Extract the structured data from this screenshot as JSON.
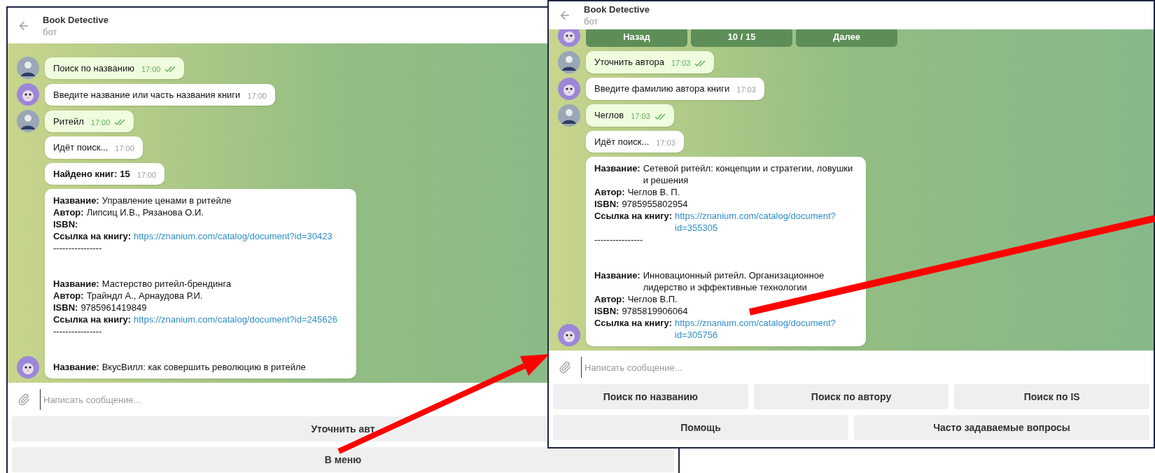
{
  "windows": [
    {
      "title": "Book Detective",
      "subtitle": "бот",
      "messages": [
        {
          "kind": "outgoing",
          "text": "Поиск по названию",
          "time": "17:00",
          "read": true,
          "avatar": true
        },
        {
          "kind": "incoming",
          "text": "Введите название или часть названия книги",
          "time": "17:00",
          "bold": false,
          "avatar": true
        },
        {
          "kind": "outgoing",
          "text": "Ритейл",
          "time": "17:00",
          "read": true,
          "avatar": true
        },
        {
          "kind": "incoming",
          "text": "Идёт поиск...",
          "time": "17:00",
          "bold": false
        },
        {
          "kind": "incoming",
          "text": "Найдено книг: 15",
          "time": "17:00",
          "bold": true
        },
        {
          "kind": "books",
          "avatar": true,
          "lines": [
            {
              "kind": "field",
              "label": "Название:",
              "value": "Управление ценами в ритейле"
            },
            {
              "kind": "field",
              "label": "Автор:",
              "value": "Липсиц И.В., Рязанова О.И."
            },
            {
              "kind": "field",
              "label": "ISBN:"
            },
            {
              "kind": "link",
              "label": "Ссылка на книгу:",
              "url": "https://znanium.com/catalog/document?id=30423"
            },
            {
              "kind": "rule",
              "text": "----------------"
            },
            {
              "kind": "gap"
            },
            {
              "kind": "gap"
            },
            {
              "kind": "field",
              "label": "Название:",
              "value": "Мастерство ритейл-брендинга"
            },
            {
              "kind": "field",
              "label": "Автор:",
              "value": "Трайндл А., Арнаудова Р.И."
            },
            {
              "kind": "field",
              "label": "ISBN:",
              "value": "9785961419849"
            },
            {
              "kind": "link",
              "label": "Ссылка на книгу:",
              "url": "https://znanium.com/catalog/document?id=245626"
            },
            {
              "kind": "rule",
              "text": "----------------"
            },
            {
              "kind": "gap"
            },
            {
              "kind": "gap"
            },
            {
              "kind": "field",
              "label": "Название:",
              "value": "ВкусВилл: как совершить революцию в ритейле"
            }
          ]
        }
      ],
      "input": {
        "placeholder": "Написать сообщение..."
      },
      "keyboard": [
        {
          "buttons": [
            "Уточнить авт"
          ]
        },
        {
          "buttons": [
            "В меню"
          ]
        }
      ]
    },
    {
      "title": "Book Detective",
      "subtitle": "бот",
      "messages": [
        {
          "kind": "buttons",
          "buttons": [
            "Назад",
            "10 / 15",
            "Далее"
          ],
          "avatar": true
        },
        {
          "kind": "outgoing",
          "text": "Уточнить автора",
          "time": "17:03",
          "read": true,
          "avatar": true
        },
        {
          "kind": "incoming",
          "text": "Введите фамилию автора книги",
          "time": "17:03",
          "bold": false,
          "avatar": true
        },
        {
          "kind": "outgoing",
          "text": "Чеглов",
          "time": "17:03",
          "read": true,
          "avatar": true
        },
        {
          "kind": "incoming",
          "text": "Идёт поиск...",
          "time": "17:03",
          "bold": false
        },
        {
          "kind": "books",
          "avatar": true,
          "lines": [
            {
              "kind": "field",
              "label": "Название:",
              "value": "Сетевой ритейл: концепции и стратегии, ловушки и решения"
            },
            {
              "kind": "field",
              "label": "Автор:",
              "value": "Чеглов В. П."
            },
            {
              "kind": "field",
              "label": "ISBN:",
              "value": "9785955802954"
            },
            {
              "kind": "link",
              "label": "Ссылка на книгу:",
              "url": "https://znanium.com/catalog/document?id=355305"
            },
            {
              "kind": "rule",
              "text": "----------------"
            },
            {
              "kind": "gap"
            },
            {
              "kind": "gap"
            },
            {
              "kind": "field",
              "label": "Название:",
              "value": "Инновационный ритейл. Организационное лидерство и эффективные технологии"
            },
            {
              "kind": "field",
              "label": "Автор:",
              "value": "Чеглов В.П."
            },
            {
              "kind": "field",
              "label": "ISBN:",
              "value": "9785819906064"
            },
            {
              "kind": "link",
              "label": "Ссылка на книгу:",
              "url": "https://znanium.com/catalog/document?id=305756"
            }
          ]
        }
      ],
      "input": {
        "placeholder": "Написать сообщение..."
      },
      "keyboard": [
        {
          "buttons": [
            "Поиск по названию",
            "Поиск по автору",
            "Поиск по IS"
          ]
        },
        {
          "buttons": [
            "Помощь",
            "Часто задаваемые вопросы"
          ]
        }
      ]
    }
  ]
}
